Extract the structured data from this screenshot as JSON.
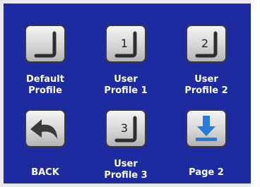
{
  "profiles": [
    {
      "line1": "Default",
      "line2": "Profile",
      "number": ""
    },
    {
      "line1": "User",
      "line2": "Profile 1",
      "number": "1"
    },
    {
      "line1": "User",
      "line2": "Profile 2",
      "number": "2"
    },
    {
      "line1": "",
      "line2": "BACK",
      "icon": "back-arrow-icon"
    },
    {
      "line1": "User",
      "line2": "Profile 3",
      "number": "3"
    },
    {
      "line1": "",
      "line2": "Page 2",
      "icon": "page-down-arrow-icon"
    }
  ],
  "colors": {
    "background": "#1e2aa0",
    "button_face": "#d6d6d6",
    "page_arrow": "#2a7ad8",
    "label_text": "#ffffff"
  }
}
